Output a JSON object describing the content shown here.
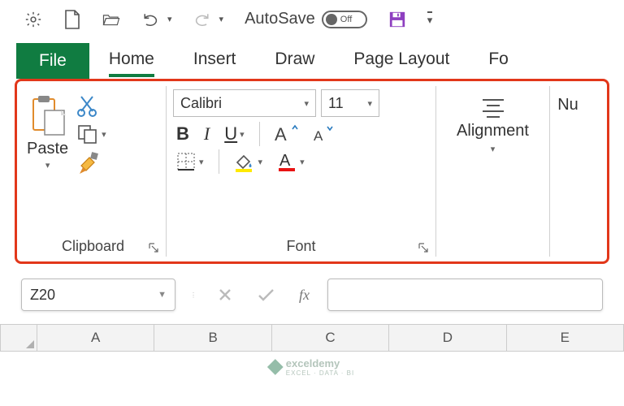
{
  "qat": {
    "autosave_label": "AutoSave",
    "autosave_state": "Off"
  },
  "tabs": {
    "file": "File",
    "home": "Home",
    "insert": "Insert",
    "draw": "Draw",
    "page_layout": "Page Layout",
    "formulas": "Fo"
  },
  "ribbon": {
    "clipboard": {
      "paste": "Paste",
      "label": "Clipboard"
    },
    "font": {
      "name": "Calibri",
      "size": "11",
      "label": "Font",
      "bold": "B",
      "italic": "I",
      "underline": "U"
    },
    "alignment": {
      "label": "Alignment"
    },
    "number": {
      "label": "Nu"
    }
  },
  "formula_bar": {
    "cell_ref": "Z20",
    "fx": "fx"
  },
  "columns": [
    "A",
    "B",
    "C",
    "D",
    "E"
  ],
  "watermark": {
    "brand": "exceldemy",
    "sub": "EXCEL · DATA · BI"
  }
}
